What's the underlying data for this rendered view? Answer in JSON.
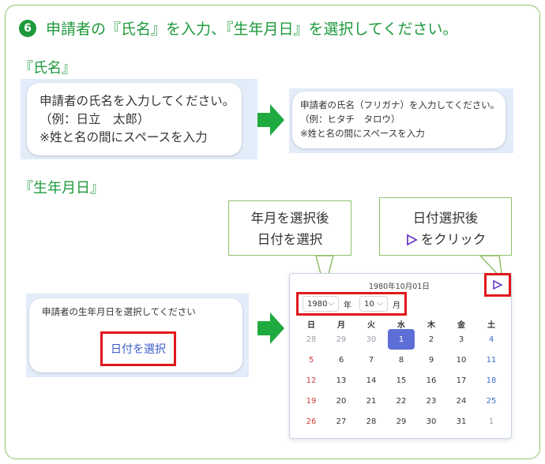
{
  "header": {
    "step_badge": "6",
    "title": "申請者の『氏名』を入力、『生年月日』を選択してください。"
  },
  "name_section": {
    "label": "『氏名』",
    "bubble1_lines": [
      "申請者の氏名を入力してください。",
      "（例：日立　太郎）",
      "※姓と名の間にスペースを入力"
    ],
    "bubble2_lines": [
      "申請者の氏名（フリガナ）を入力してください。",
      "（例：ヒタチ　タロウ）",
      "※姓と名の間にスペースを入力"
    ]
  },
  "birth_section": {
    "label": "『生年月日』",
    "prompt": "申請者の生年月日を選択してください",
    "date_button": "日付を選択",
    "callout_left_lines": [
      "年月を選択後",
      "日付を選択"
    ],
    "callout_right_line1": "日付選択後",
    "callout_right_line2": "をクリック",
    "send_glyph": "⊳"
  },
  "calendar": {
    "selected_date_label": "1980年10月01日",
    "year_value": "1980",
    "year_unit": "年",
    "month_value": "10",
    "month_unit": "月",
    "weekdays": [
      "日",
      "月",
      "火",
      "水",
      "木",
      "金",
      "土"
    ],
    "weeks": [
      [
        "28",
        "29",
        "30",
        "1",
        "2",
        "3",
        "4"
      ],
      [
        "5",
        "6",
        "7",
        "8",
        "9",
        "10",
        "11"
      ],
      [
        "12",
        "13",
        "14",
        "15",
        "16",
        "17",
        "18"
      ],
      [
        "19",
        "20",
        "21",
        "22",
        "23",
        "24",
        "25"
      ],
      [
        "26",
        "27",
        "28",
        "29",
        "30",
        "31",
        "1"
      ]
    ],
    "muted_cells": [
      [
        0,
        0
      ],
      [
        0,
        1
      ],
      [
        0,
        2
      ],
      [
        4,
        6
      ]
    ],
    "selected_cell": [
      0,
      3
    ],
    "colors": {
      "accent": "#5d6fd6",
      "sunday": "#d0393a",
      "saturday": "#3d6fc8",
      "highlight": "#e0181c",
      "green": "#1e9a3c"
    }
  }
}
